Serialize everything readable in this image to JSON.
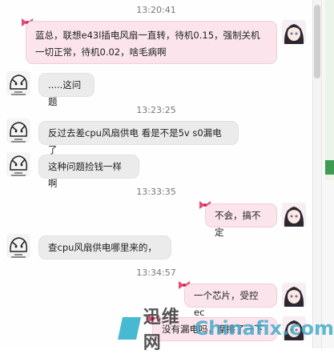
{
  "chat": {
    "timestamps": [
      "13:20:41",
      "13:23:25",
      "13:33:35",
      "13:34:57"
    ],
    "messages": [
      {
        "dir": "out",
        "lines": [
          "蓝总，联想e43l插电风扇一直转，待机0.15，强制关机",
          "一切正常，待机0.02，啥毛病啊"
        ]
      },
      {
        "dir": "in",
        "lines": [
          ".....这问题"
        ]
      },
      {
        "dir": "in",
        "lines": [
          "反过去差cpu风扇供电 看是不是5v s0漏电了"
        ]
      },
      {
        "dir": "in",
        "lines": [
          "这种问题捡钱一样啊"
        ]
      },
      {
        "dir": "out",
        "lines": [
          "不会，搞不定"
        ]
      },
      {
        "dir": "in",
        "lines": [
          "查cpu风扇供电哪里来的，"
        ]
      },
      {
        "dir": "out",
        "lines": [
          "一个芯片，受控ec"
        ]
      },
      {
        "dir": "out",
        "lines": [
          "没有漏电吗，摩擦了一下"
        ]
      }
    ]
  },
  "watermark": {
    "text": "迅维网",
    "domain": "Chinafix.com"
  },
  "colors": {
    "out_bubble": "#fbe4ec",
    "in_bubble": "#ebebeb",
    "timestamp": "#777777",
    "watermark_accent": "#1aa9c9"
  },
  "icons": {
    "outgoing_avatar": "anime-girl-avatar-icon",
    "incoming_avatar": "sketch-character-avatar-icon",
    "bubble_decoration": "pink-bow-icon"
  }
}
